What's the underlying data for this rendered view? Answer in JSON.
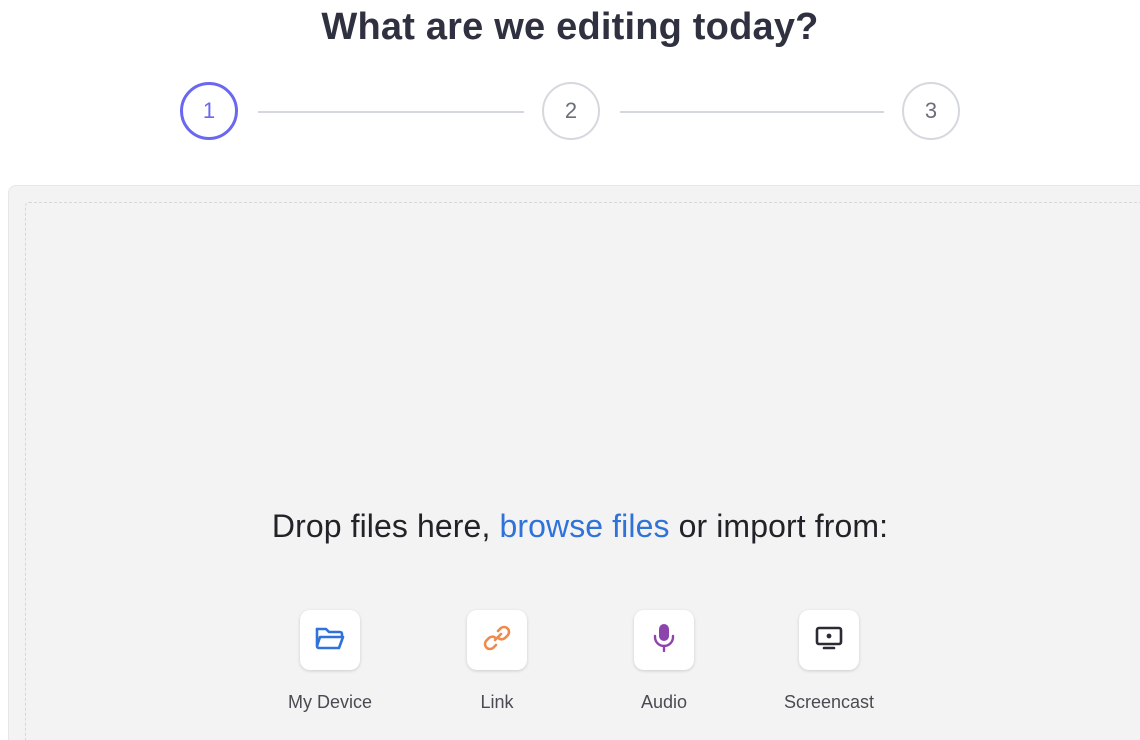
{
  "header": {
    "title": "What are we editing today?"
  },
  "steps": [
    {
      "label": "1",
      "active": true
    },
    {
      "label": "2",
      "active": false
    },
    {
      "label": "3",
      "active": false
    }
  ],
  "dropzone": {
    "prefix": "Drop files here, ",
    "browse_label": "browse files",
    "suffix": " or import from:"
  },
  "sources": [
    {
      "label": "My Device",
      "icon": "folder-icon",
      "color": "#2f73d9"
    },
    {
      "label": "Link",
      "icon": "link-icon",
      "color": "#f08a4b"
    },
    {
      "label": "Audio",
      "icon": "microphone-icon",
      "color": "#8e44ad"
    },
    {
      "label": "Screencast",
      "icon": "screen-icon",
      "color": "#2b2b36"
    }
  ],
  "colors": {
    "accent": "#6a67f0",
    "link": "#2f73d9",
    "dropzone_bg": "#f3f3f3"
  }
}
